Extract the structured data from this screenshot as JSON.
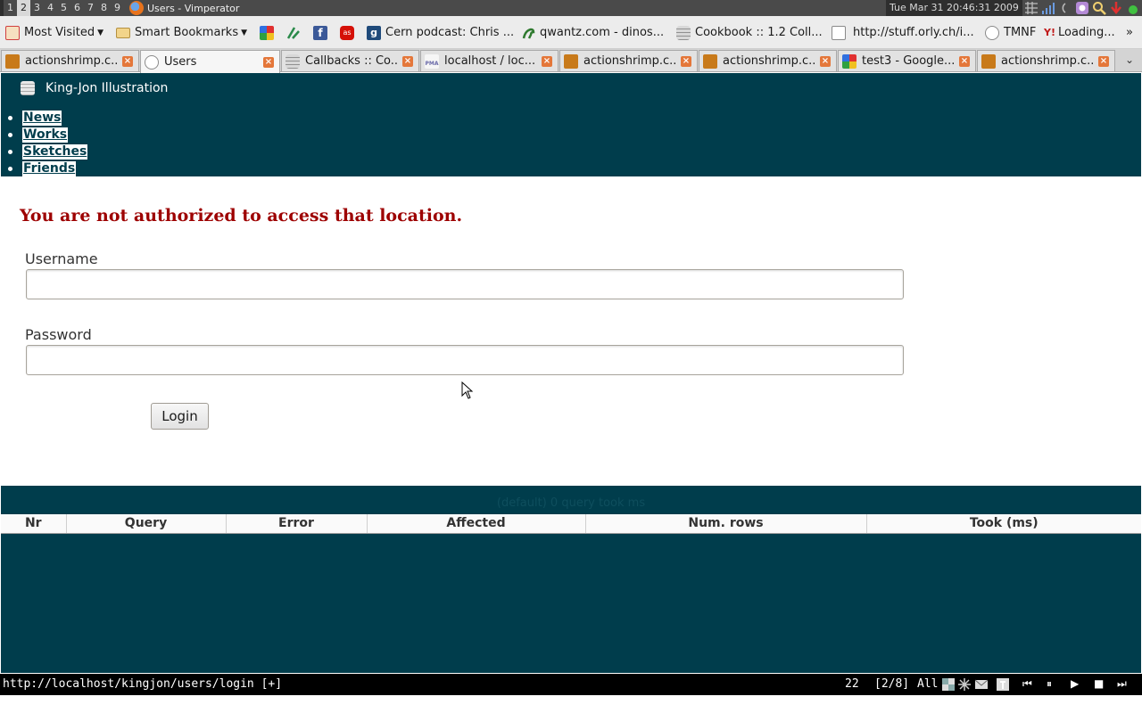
{
  "wm": {
    "workspaces": [
      "1",
      "2",
      "3",
      "4",
      "5",
      "6",
      "7",
      "8",
      "9"
    ],
    "active_workspace": "2",
    "window_title": "Users - Vimperator",
    "clock": "Tue Mar 31 20:46:31 2009"
  },
  "bookmarks": [
    {
      "label": "Most Visited",
      "icon": "most-visited-icon"
    },
    {
      "label": "Smart Bookmarks",
      "icon": "folder-icon"
    },
    {
      "label": "",
      "icon": "google-icon"
    },
    {
      "label": "",
      "icon": "delicious-icon"
    },
    {
      "label": "",
      "icon": "facebook-icon"
    },
    {
      "label": "",
      "icon": "lastfm-icon"
    },
    {
      "label": "Cern podcast: Chris ...",
      "icon": "podcast-icon"
    },
    {
      "label": "qwantz.com - dinos...",
      "icon": "dinosaur-icon"
    },
    {
      "label": "Cookbook :: 1.2 Coll...",
      "icon": "cake-icon"
    },
    {
      "label": "http://stuff.orly.ch/i...",
      "icon": "page-icon"
    },
    {
      "label": "TMNF",
      "icon": "page-icon"
    },
    {
      "label": "Loading...",
      "icon": "yahoo-icon"
    }
  ],
  "tabs": [
    {
      "label": "actionshrimp.c...",
      "icon": "shrimp-icon",
      "active": false
    },
    {
      "label": "Users",
      "icon": "page-icon",
      "active": true
    },
    {
      "label": "Callbacks :: Co...",
      "icon": "cake-icon",
      "active": false
    },
    {
      "label": "localhost / loc...",
      "icon": "phpmyadmin-icon",
      "active": false
    },
    {
      "label": "actionshrimp.c...",
      "icon": "shrimp-icon",
      "active": false
    },
    {
      "label": "actionshrimp.c...",
      "icon": "shrimp-icon",
      "active": false
    },
    {
      "label": "test3 - Google...",
      "icon": "google-icon",
      "active": false
    },
    {
      "label": "actionshrimp.c...",
      "icon": "shrimp-icon",
      "active": false
    }
  ],
  "page": {
    "site_title": "King-Jon Illustration",
    "nav": [
      "News",
      "Works",
      "Sketches",
      "Friends"
    ],
    "flash_message": "You are not authorized to access that location.",
    "username_label": "Username",
    "username_value": "",
    "password_label": "Password",
    "password_value": "",
    "login_label": "Login",
    "sql_caption": "(default) 0 query took ms",
    "sql_columns": [
      "Nr",
      "Query",
      "Error",
      "Affected",
      "Num. rows",
      "Took (ms)"
    ]
  },
  "status": {
    "url": "http://localhost/kingjon/users/login [+]",
    "line": "22",
    "tab_position": "[2/8]",
    "scroll": "All"
  },
  "colors": {
    "header_bg": "#003d4c",
    "flash_red": "#9d0000",
    "status_bg": "#000000"
  }
}
